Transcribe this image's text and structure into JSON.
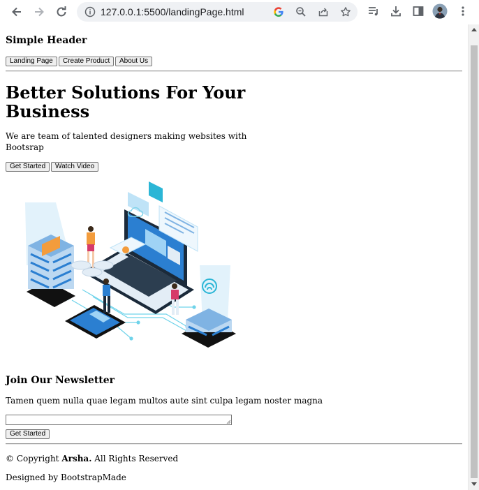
{
  "browser": {
    "url": "127.0.0.1:5500/landingPage.html"
  },
  "header": {
    "title": "Simple Header",
    "nav": [
      "Landing Page",
      "Create Product",
      "About Us"
    ]
  },
  "hero": {
    "title_line1": "Better Solutions For Your",
    "title_line2": "Business",
    "subtitle_line1": "We are team of talented designers making websites with",
    "subtitle_line2": "Bootsrap",
    "get_started": "Get Started",
    "watch_video": "Watch Video"
  },
  "newsletter": {
    "title": "Join Our Newsletter",
    "text": "Tamen quem nulla quae legam multos aute sint culpa legam noster magna",
    "input_value": "",
    "button": "Get Started"
  },
  "footer": {
    "copyright_prefix": "© Copyright ",
    "brand": "Arsha.",
    "copyright_suffix": " All Rights Reserved",
    "designed_by": "Designed by BootstrapMade"
  },
  "colors": {
    "accent_blue": "#1a73e8",
    "illustration_blue": "#2b7fd1",
    "illustration_light": "#bfe3f7"
  }
}
